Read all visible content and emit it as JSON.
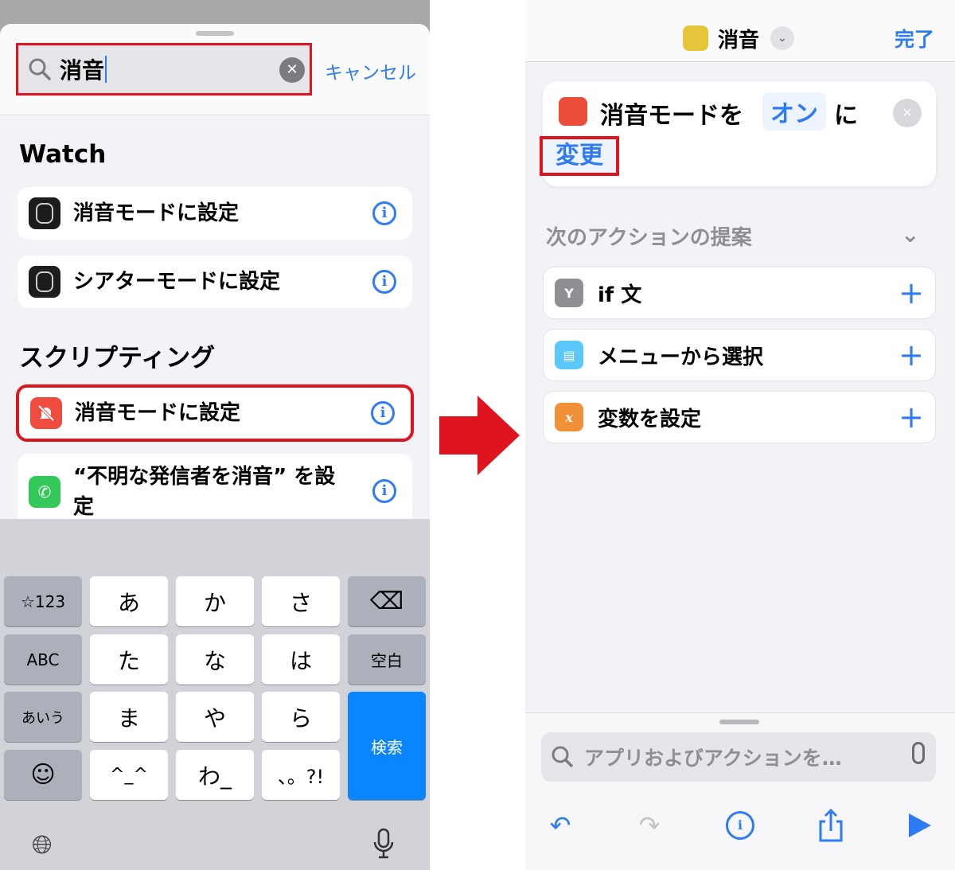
{
  "left": {
    "search": {
      "value": "消音",
      "cancel": "キャンセル"
    },
    "sections": [
      {
        "title": "Watch",
        "items": [
          {
            "label": "消音モードに設定",
            "icon": "apple-watch-icon"
          },
          {
            "label": "シアターモードに設定",
            "icon": "apple-watch-icon"
          }
        ]
      },
      {
        "title": "スクリプティング",
        "items": [
          {
            "label": "消音モードに設定",
            "icon": "bell-slash-icon"
          },
          {
            "label": "“不明な発信者を消音” を設定",
            "icon": "phone-icon"
          }
        ]
      }
    ],
    "keyboard": {
      "keys": [
        "☆123",
        "あ",
        "か",
        "さ",
        "⌫",
        "ABC",
        "た",
        "な",
        "は",
        "空白",
        "あいう",
        "ま",
        "や",
        "ら",
        "検索",
        "☺",
        "^_^",
        "わ_",
        "、。?!"
      ]
    }
  },
  "right": {
    "header": {
      "title": "消音",
      "done": "完了"
    },
    "action": {
      "text1": "消音モードを",
      "token_on": "オン",
      "text2": "に",
      "token_change": "変更"
    },
    "suggestions": {
      "title": "次のアクションの提案",
      "items": [
        {
          "label": "if 文",
          "icon_color": "#8e8e93"
        },
        {
          "label": "メニューから選択",
          "icon_color": "#5ac8fa"
        },
        {
          "label": "変数を設定",
          "icon_color": "#f0913a",
          "glyph": "x"
        }
      ]
    },
    "search_placeholder": "アプリおよびアクションを…"
  },
  "colors": {
    "accent": "#2f7bf6",
    "highlight": "#e0141e"
  }
}
